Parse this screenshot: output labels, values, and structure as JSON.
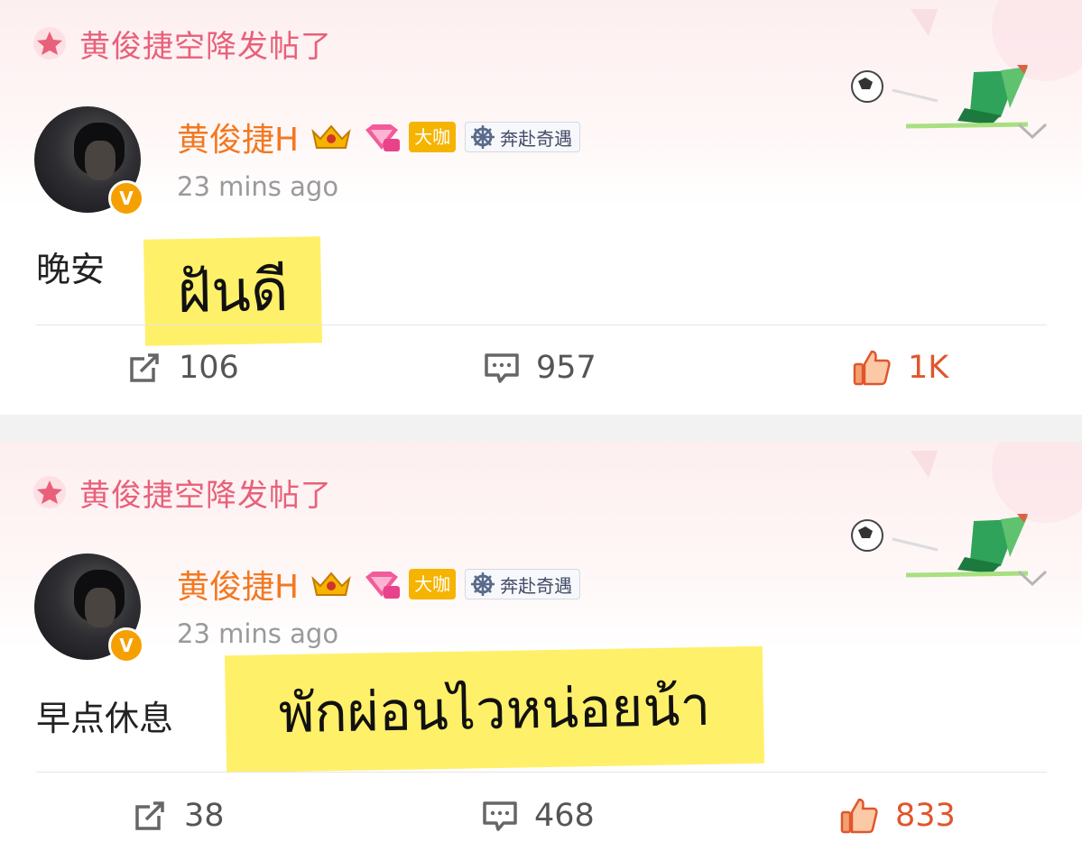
{
  "colors": {
    "accent": "#f27821",
    "like": "#e0562c",
    "banner": "#e8607a",
    "highlight": "#fff06a"
  },
  "posts": [
    {
      "banner_text": "黄俊捷空降发帖了",
      "username": "黄俊捷H",
      "badge_dk": "大咖",
      "topic_label": "奔赴奇遇",
      "verified": "V",
      "time": "23 mins ago",
      "content": "晚安",
      "translation": "ฝันดี",
      "reposts": "106",
      "comments": "957",
      "likes": "1K"
    },
    {
      "banner_text": "黄俊捷空降发帖了",
      "username": "黄俊捷H",
      "badge_dk": "大咖",
      "topic_label": "奔赴奇遇",
      "verified": "V",
      "time": "23 mins ago",
      "content": "早点休息",
      "translation": "พักผ่อนไวหน่อยน้า",
      "reposts": "38",
      "comments": "468",
      "likes": "833"
    }
  ],
  "icons": [
    "star-badge-icon",
    "crown-icon",
    "diamond-level-icon",
    "wheel-icon",
    "chevron-down-icon",
    "repost-icon",
    "comment-icon",
    "like-icon",
    "football-decoration-icon"
  ]
}
